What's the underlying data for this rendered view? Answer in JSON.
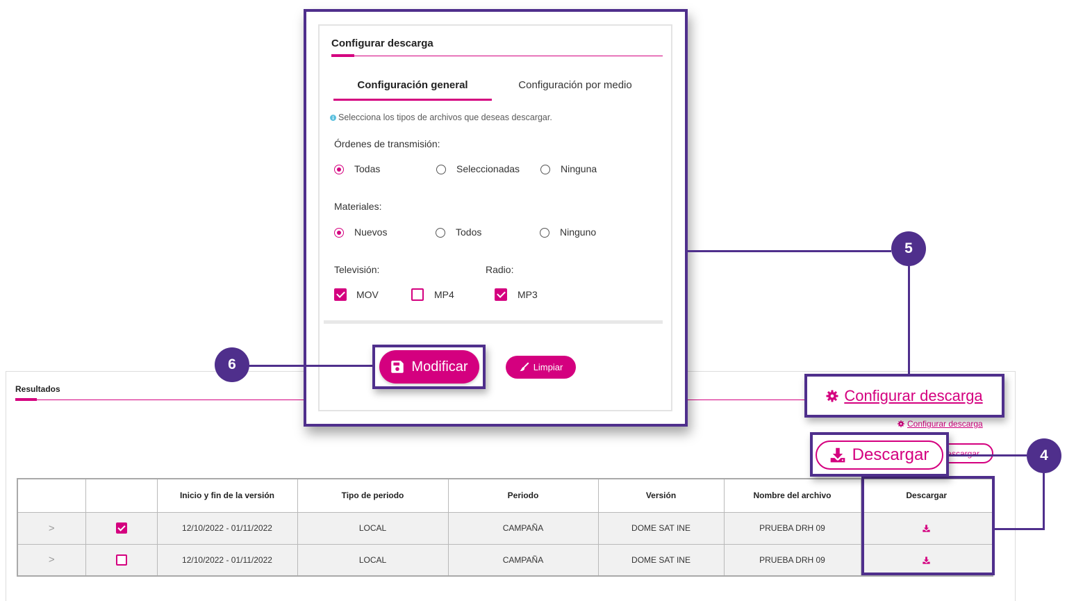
{
  "colors": {
    "accent": "#d4007f",
    "callout": "#4f2f8c",
    "info": "#5bc0de",
    "row_bg": "#f1f1f1"
  },
  "icons": {
    "config": "gear-icon",
    "download": "download-icon",
    "modify": "save-icon",
    "clear": "brush-icon",
    "info": "info-icon"
  },
  "results": {
    "title": "Resultados",
    "config_link": "Configurar descarga",
    "download_button": "Descargar",
    "table": {
      "headers": {
        "dates": "Inicio y fin de la versión",
        "period_type": "Tipo de periodo",
        "period": "Periodo",
        "version": "Versión",
        "file_name": "Nombre del archivo",
        "download": "Descargar"
      },
      "rows": [
        {
          "expand": ">",
          "selected": true,
          "dates": "12/10/2022 - 01/11/2022",
          "period_type": "LOCAL",
          "period": "CAMPAÑA",
          "version": "DOME SAT INE",
          "file_name": "PRUEBA DRH 09"
        },
        {
          "expand": ">",
          "selected": false,
          "dates": "12/10/2022 - 01/11/2022",
          "period_type": "LOCAL",
          "period": "CAMPAÑA",
          "version": "DOME SAT INE",
          "file_name": "PRUEBA DRH 09"
        }
      ]
    }
  },
  "modal": {
    "title": "Configurar descarga",
    "tabs": [
      {
        "label": "Configuración general",
        "active": true
      },
      {
        "label": "Configuración por medio",
        "active": false
      }
    ],
    "info": "Selecciona los tipos de archivos que deseas descargar.",
    "orders": {
      "label": "Órdenes de transmisión:",
      "options": [
        {
          "label": "Todas",
          "checked": true
        },
        {
          "label": "Seleccionadas",
          "checked": false
        },
        {
          "label": "Ninguna",
          "checked": false
        }
      ]
    },
    "materials": {
      "label": "Materiales:",
      "options": [
        {
          "label": "Nuevos",
          "checked": true
        },
        {
          "label": "Todos",
          "checked": false
        },
        {
          "label": "Ninguno",
          "checked": false
        }
      ]
    },
    "television": {
      "label": "Televisión:",
      "options": [
        {
          "label": "MOV",
          "checked": true
        },
        {
          "label": "MP4",
          "checked": false
        }
      ]
    },
    "radio": {
      "label": "Radio:",
      "options": [
        {
          "label": "MP3",
          "checked": true
        }
      ]
    },
    "modify_button": "Modificar",
    "clear_button": "Limpiar"
  },
  "callouts": {
    "download": {
      "number": "4",
      "label": "Descargar"
    },
    "configure": {
      "number": "5",
      "label": "Configurar descarga"
    },
    "modify": {
      "number": "6"
    }
  }
}
